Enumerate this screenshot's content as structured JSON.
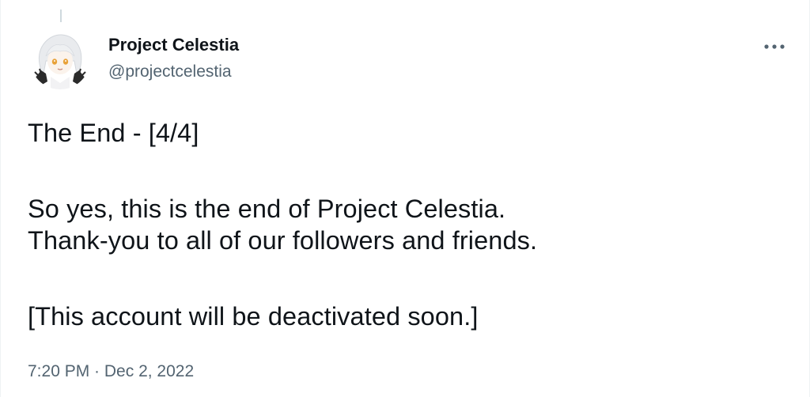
{
  "author": {
    "display_name": "Project Celestia",
    "handle": "@projectcelestia",
    "avatar_icon": "anime-girl-avatar-icon"
  },
  "menu": {
    "more_icon": "more-options-icon",
    "more_label": "•••"
  },
  "tweet": {
    "lines": [
      "The End - [4/4]",
      "So yes, this is the end of Project Celestia.",
      "Thank-you to all of our followers and friends.",
      "[This account will be deactivated soon.]"
    ]
  },
  "meta": {
    "time": "7:20 PM",
    "separator": " · ",
    "date": "Dec 2, 2022"
  },
  "colors": {
    "text_primary": "#0f1419",
    "text_secondary": "#536471",
    "border": "#eff3f4"
  }
}
